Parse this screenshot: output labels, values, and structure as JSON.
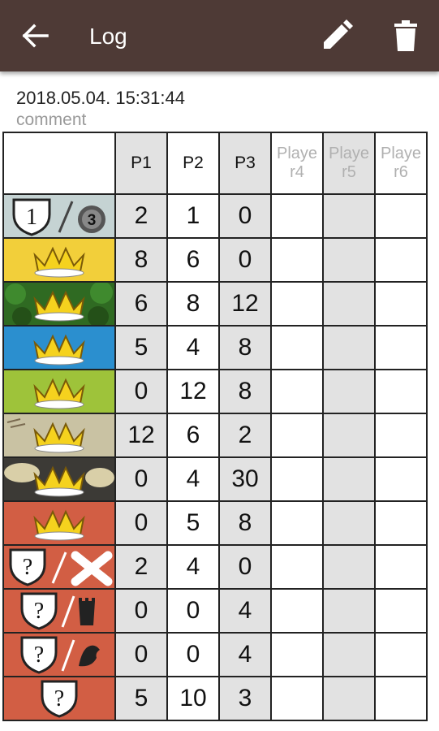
{
  "app_bar": {
    "title": "Log",
    "back_icon": "arrow-back-icon",
    "edit_icon": "pencil-icon",
    "delete_icon": "trash-icon",
    "background": "#4e3a36"
  },
  "log": {
    "datetime": "2018.05.04. 15:31:44",
    "comment": "comment"
  },
  "table": {
    "columns": [
      "P1",
      "P2",
      "P3",
      "Playe r4",
      "Playe r5",
      "Playe r6"
    ],
    "rows": [
      {
        "icon": "shield-1-vs-3-icon",
        "label": "1",
        "label2": "3",
        "values": [
          "2",
          "1",
          "0",
          "",
          "",
          ""
        ]
      },
      {
        "icon": "crown-yellow-icon",
        "values": [
          "8",
          "6",
          "0",
          "",
          "",
          ""
        ]
      },
      {
        "icon": "crown-forest-icon",
        "values": [
          "6",
          "8",
          "12",
          "",
          "",
          ""
        ]
      },
      {
        "icon": "crown-water-icon",
        "values": [
          "5",
          "4",
          "8",
          "",
          "",
          ""
        ]
      },
      {
        "icon": "crown-grass-icon",
        "values": [
          "0",
          "12",
          "8",
          "",
          "",
          ""
        ]
      },
      {
        "icon": "crown-swamp-icon",
        "values": [
          "12",
          "6",
          "2",
          "",
          "",
          ""
        ]
      },
      {
        "icon": "crown-mine-icon",
        "values": [
          "0",
          "4",
          "30",
          "",
          "",
          ""
        ]
      },
      {
        "icon": "crown-castle-icon",
        "values": [
          "0",
          "5",
          "8",
          "",
          "",
          ""
        ]
      },
      {
        "icon": "question-shield-cross-icon",
        "label": "?",
        "values": [
          "2",
          "4",
          "0",
          "",
          "",
          ""
        ]
      },
      {
        "icon": "question-shield-tower-icon",
        "label": "?",
        "values": [
          "0",
          "0",
          "4",
          "",
          "",
          ""
        ]
      },
      {
        "icon": "question-shield-bird-icon",
        "label": "?",
        "values": [
          "0",
          "0",
          "4",
          "",
          "",
          ""
        ]
      },
      {
        "icon": "question-shield-icon",
        "label": "?",
        "values": [
          "5",
          "10",
          "3",
          "",
          "",
          ""
        ]
      }
    ]
  }
}
